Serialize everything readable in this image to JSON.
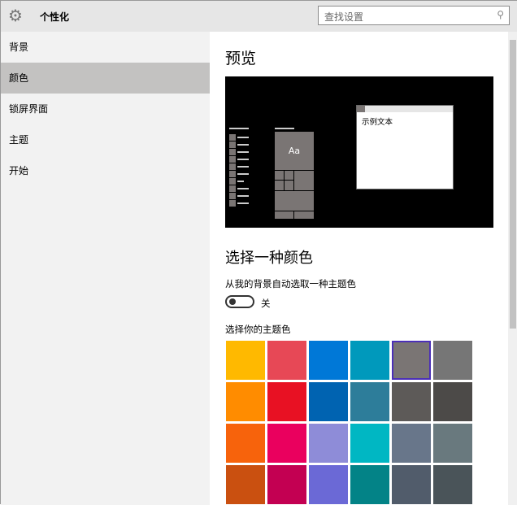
{
  "header": {
    "title": "个性化",
    "search_placeholder": "查找设置"
  },
  "sidebar": {
    "items": [
      {
        "label": "背景"
      },
      {
        "label": "颜色",
        "selected": true
      },
      {
        "label": "锁屏界面"
      },
      {
        "label": "主题"
      },
      {
        "label": "开始"
      }
    ]
  },
  "main": {
    "preview_title": "预览",
    "preview": {
      "tile_text": "Aa",
      "window_text": "示例文本"
    },
    "color_title": "选择一种颜色",
    "auto_label": "从我的背景自动选取一种主题色",
    "toggle_state": "关",
    "accent_label": "选择你的主题色",
    "selected_color": "#7A7574",
    "swatches": [
      "#FFB900",
      "#E74856",
      "#0078D7",
      "#0099BC",
      "#7A7574",
      "#767676",
      "#FF8C00",
      "#E81123",
      "#0063B1",
      "#2D7D9A",
      "#5D5A58",
      "#4C4A48",
      "#F7630C",
      "#EA005E",
      "#8E8CD8",
      "#00B7C3",
      "#68768A",
      "#69797E",
      "#CA5010",
      "#C30052",
      "#6B69D6",
      "#038387",
      "#515C6B",
      "#4A5459"
    ]
  }
}
